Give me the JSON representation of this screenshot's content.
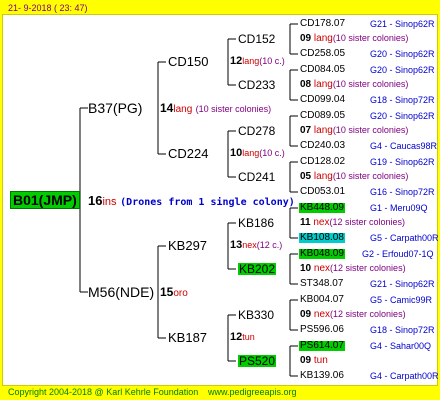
{
  "header": {
    "timestamp": "21-  9-2018 (  23:  47)"
  },
  "root": {
    "id": "B01(JMP)",
    "count": "16",
    "lbl": "ins",
    "drones": "(Drones from 1 single colony)"
  },
  "queen": {
    "id": "B37(PG)",
    "count": "14",
    "lbl": "lang",
    "sis": "(10 sister colonies)"
  },
  "drone_side": {
    "id": "M56(NDE)",
    "count": "15",
    "lbl": "oro"
  },
  "g2": [
    {
      "id": "CD150",
      "count": "12",
      "lbl": "lang",
      "sis": "(10 c.)"
    },
    {
      "id": "CD224",
      "count": "10",
      "lbl": "lang",
      "sis": "(10 c.)"
    },
    {
      "id": "KB297",
      "count": "13",
      "lbl": "nex",
      "sis": "(12 c.)"
    },
    {
      "id": "KB187",
      "count": "12",
      "lbl": "tun",
      "sis": ""
    }
  ],
  "g3": [
    {
      "id": "CD152",
      "count": "",
      "lbl": "",
      "sis": ""
    },
    {
      "id": "CD233",
      "count": "",
      "lbl": "",
      "sis": ""
    },
    {
      "id": "CD278",
      "count": "",
      "lbl": "",
      "sis": ""
    },
    {
      "id": "CD241",
      "count": "",
      "lbl": "",
      "sis": ""
    },
    {
      "id": "KB186",
      "count": "",
      "lbl": "",
      "sis": ""
    },
    {
      "id": "KB202",
      "count": "",
      "lbl": "",
      "sis": ""
    },
    {
      "id": "KB330",
      "count": "",
      "lbl": "",
      "sis": ""
    },
    {
      "id": "PS520",
      "count": "",
      "lbl": "",
      "sis": ""
    }
  ],
  "leaves": [
    {
      "id": "CD178.07",
      "right": "G21 - Sinop62R"
    },
    {
      "count": "09",
      "lbl": "lang",
      "sis": "(10 sister colonies)"
    },
    {
      "id": "CD258.05",
      "right": "G20 - Sinop62R"
    },
    {
      "id": "CD084.05",
      "right": "G20 - Sinop62R"
    },
    {
      "count": "08",
      "lbl": "lang",
      "sis": "(10 sister colonies)"
    },
    {
      "id": "CD099.04",
      "right": "G18 - Sinop72R"
    },
    {
      "id": "CD089.05",
      "right": "G20 - Sinop62R"
    },
    {
      "count": "07",
      "lbl": "lang",
      "sis": "(10 sister colonies)"
    },
    {
      "id": "CD240.03",
      "right": "G4 - Caucas98R"
    },
    {
      "id": "CD128.02",
      "right": "G19 - Sinop62R"
    },
    {
      "count": "05",
      "lbl": "lang",
      "sis": "(10 sister colonies)"
    },
    {
      "id": "CD053.01",
      "right": "G16 - Sinop72R"
    },
    {
      "id": "KB448.09",
      "right": "G1 - Meru09Q"
    },
    {
      "count": "11",
      "lbl": "nex",
      "sis": "(12 sister colonies)"
    },
    {
      "id": "KB108.08",
      "right": "G5 - Carpath00R"
    },
    {
      "id": "KB048.09",
      "right": "G2 - Erfoud07-1Q"
    },
    {
      "count": "10",
      "lbl": "nex",
      "sis": "(12 sister colonies)"
    },
    {
      "id": "ST348.07",
      "right": "G21 - Sinop62R"
    },
    {
      "id": "KB004.07",
      "right": "G5 - Camic99R"
    },
    {
      "count": "09",
      "lbl": "nex",
      "sis": "(12 sister colonies)"
    },
    {
      "id": "PS596.06",
      "right": "G18 - Sinop72R"
    },
    {
      "id": "PS614.07",
      "right": "G4 - Sahar00Q"
    },
    {
      "count": "09",
      "lbl": "tun",
      "sis": ""
    },
    {
      "id": "KB139.06",
      "right": "G4 - Carpath00R"
    }
  ],
  "footer": {
    "copyright": "Copyright 2004-2018 @ Karl Kehrle Foundation",
    "url": "www.pedigreeapis.org"
  },
  "colors": {
    "background": "#ffff00",
    "root": "#00cc00",
    "highlight_green": "#00cc00",
    "highlight_cyan": "#00cccc",
    "label_red": "#cc0000",
    "sister_purple": "#800080",
    "right_blue": "#0000cc"
  }
}
